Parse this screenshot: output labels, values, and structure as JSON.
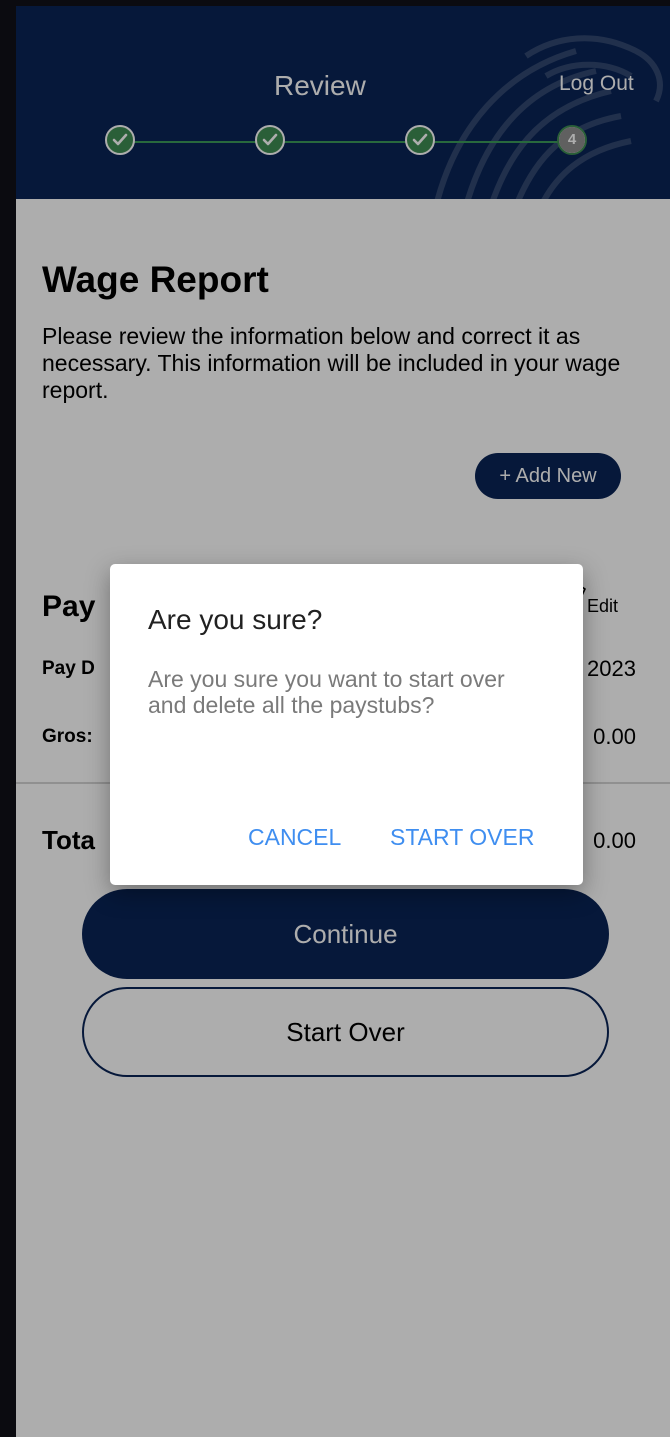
{
  "header": {
    "title": "Review",
    "logout_label": "Log Out",
    "current_step_number": "4",
    "steps_completed": 3,
    "steps_total": 4
  },
  "main": {
    "title": "Wage Report",
    "intro": "Please review the information below and correct it as necessary. This information will be included in your wage report.",
    "add_new_label": "+ Add New",
    "paystub": {
      "title": "Pay",
      "edit_label": "Edit",
      "pay_date_label": "Pay D",
      "pay_date_value": "2023",
      "gross_label": "Gros:",
      "gross_value": "0.00"
    },
    "total_label": "Tota",
    "total_value": "0.00",
    "continue_label": "Continue",
    "start_over_label": "Start Over"
  },
  "dialog": {
    "title": "Are you sure?",
    "body": "Are you sure you want to start over and delete all the paystubs?",
    "cancel_label": "CANCEL",
    "confirm_label": "START OVER"
  },
  "colors": {
    "primary_navy": "#0a2456",
    "step_green": "#3f8d53",
    "dialog_action_blue": "#3f8ef0"
  }
}
